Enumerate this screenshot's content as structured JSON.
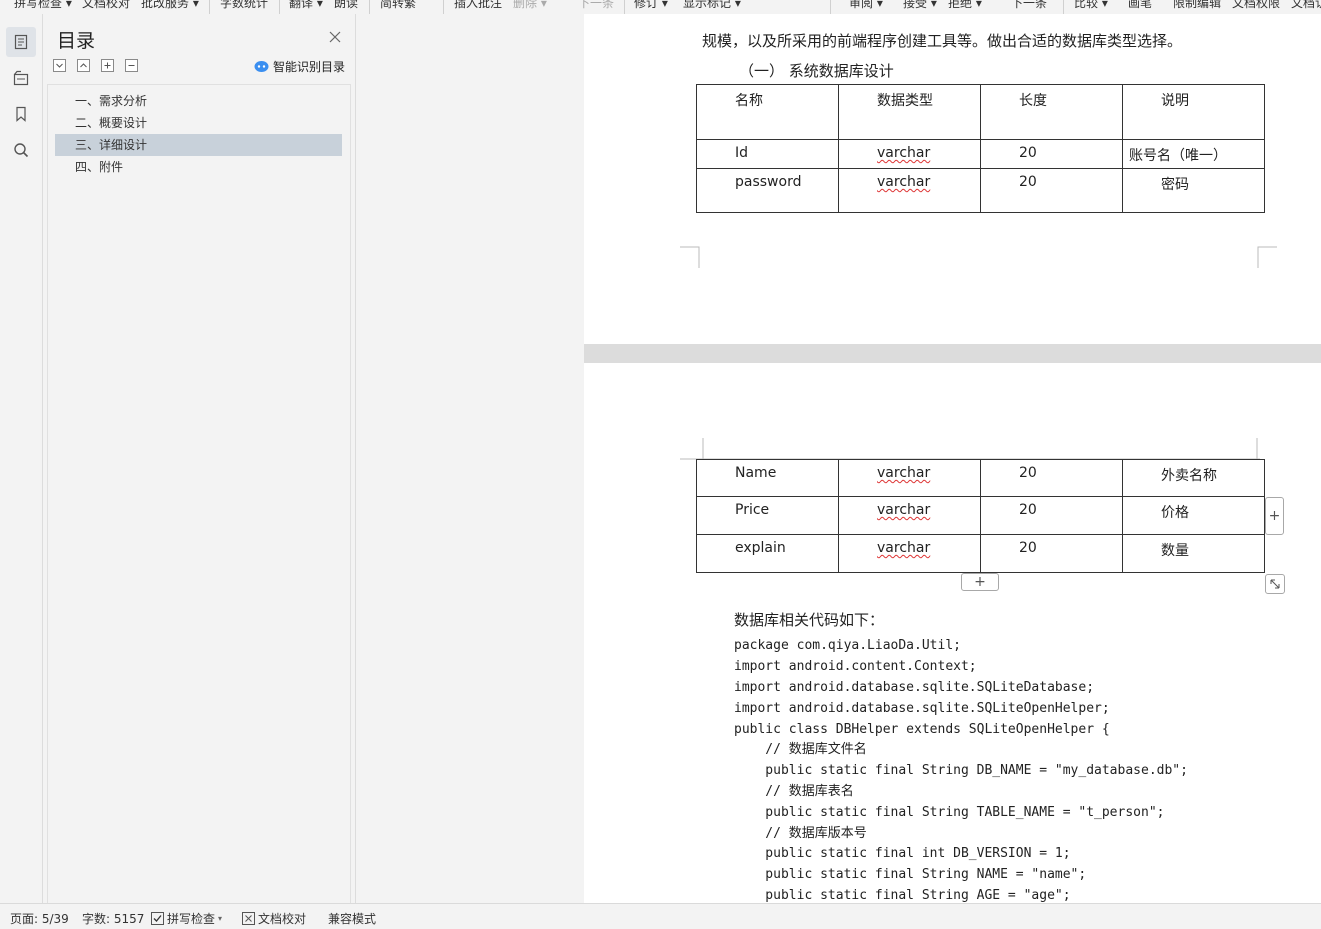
{
  "toolbar": {
    "items": [
      "拼写检查 ▾",
      "文档校对",
      "批改服务 ▾",
      "字数统计",
      "翻译 ▾",
      "朗读",
      "简转繁",
      "插入批注",
      "删除 ▾",
      "下一条",
      "修订 ▾",
      "显示标记 ▾",
      "审阅 ▾",
      "接受 ▾",
      "拒绝 ▾",
      "下一条",
      "比较 ▾",
      "画笔",
      "限制编辑",
      "文档权限",
      "文档认"
    ]
  },
  "nav": {
    "title": "目录",
    "smart_label": "智能识别目录",
    "items": [
      {
        "label": "一、需求分析"
      },
      {
        "label": "二、概要设计"
      },
      {
        "label": "三、详细设计"
      },
      {
        "label": "四、附件"
      }
    ]
  },
  "doc": {
    "intro_line": "规模，以及所采用的前端程序创建工具等。做出合适的数据库类型选择。",
    "section_heading": "（一）  系统数据库设计",
    "table1": {
      "headers": [
        "名称",
        "数据类型",
        "长度",
        "说明"
      ],
      "rows": [
        [
          "Id",
          "varchar",
          "20",
          "账号名（唯一）"
        ],
        [
          "password",
          "varchar",
          "20",
          "密码"
        ]
      ]
    },
    "table2": {
      "rows": [
        [
          "Name",
          "varchar",
          "20",
          "外卖名称"
        ],
        [
          "Price",
          "varchar",
          "20",
          "价格"
        ],
        [
          "explain",
          "varchar",
          "20",
          "数量"
        ]
      ]
    },
    "code_intro": "数据库相关代码如下：",
    "code_lines": [
      "package com.qiya.LiaoDa.Util;",
      "import android.content.Context;",
      "import android.database.sqlite.SQLiteDatabase;",
      "import android.database.sqlite.SQLiteOpenHelper;",
      "public class DBHelper extends SQLiteOpenHelper {",
      "    // 数据库文件名",
      "    public static final String DB_NAME = \"my_database.db\";",
      "    // 数据库表名",
      "    public static final String TABLE_NAME = \"t_person\";",
      "    // 数据库版本号",
      "    public static final int DB_VERSION = 1;",
      "    public static final String NAME = \"name\";",
      "    public static final String AGE = \"age\";"
    ]
  },
  "status": {
    "page": "页面: 5/39",
    "words": "字数: 5157",
    "spell": "拼写检查",
    "proof": "文档校对",
    "compat": "兼容模式"
  }
}
